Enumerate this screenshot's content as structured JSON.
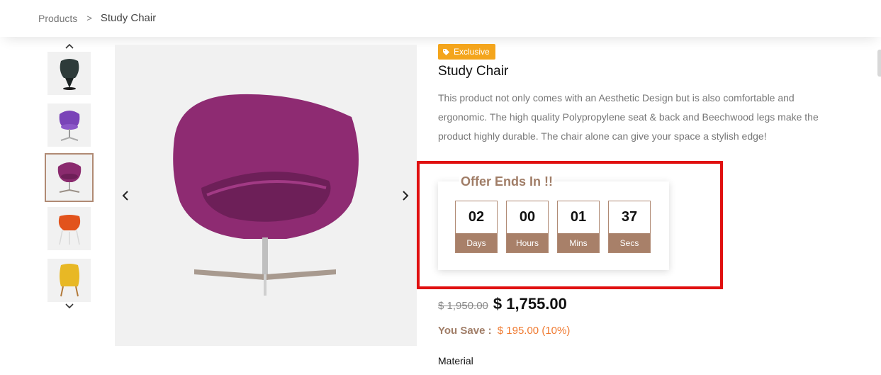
{
  "breadcrumb": {
    "root": "Products",
    "separator": ">",
    "current": "Study Chair"
  },
  "thumbnails": [
    {
      "name": "dark-green-chair",
      "color": "#2e3b3a"
    },
    {
      "name": "purple-swivel-chair",
      "color": "#7a44b8"
    },
    {
      "name": "magenta-egg-chair",
      "color": "#8a2a6e",
      "active": true
    },
    {
      "name": "orange-chair",
      "color": "#e2531c"
    },
    {
      "name": "yellow-chair",
      "color": "#e8b825"
    }
  ],
  "product": {
    "badge": "Exclusive",
    "title": "Study Chair",
    "description": "This product not only comes with an Aesthetic Design but is also comfortable and ergonomic. The high quality Polypropylene seat & back and Beechwood legs make the product highly durable. The chair alone can give your space a stylish edge!"
  },
  "offer": {
    "title": "Offer Ends In !!",
    "timer": [
      {
        "value": "02",
        "label": "Days"
      },
      {
        "value": "00",
        "label": "Hours"
      },
      {
        "value": "01",
        "label": "Mins"
      },
      {
        "value": "37",
        "label": "Secs"
      }
    ]
  },
  "pricing": {
    "old_price": "$ 1,950.00",
    "new_price": "$ 1,755.00",
    "save_label": "You Save :",
    "save_amount": "$ 195.00 (10%)"
  },
  "material_label": "Material",
  "colors": {
    "accent": "#a88069",
    "badge": "#f4a51c",
    "highlight": "#e01010",
    "savings": "#f07a30"
  }
}
